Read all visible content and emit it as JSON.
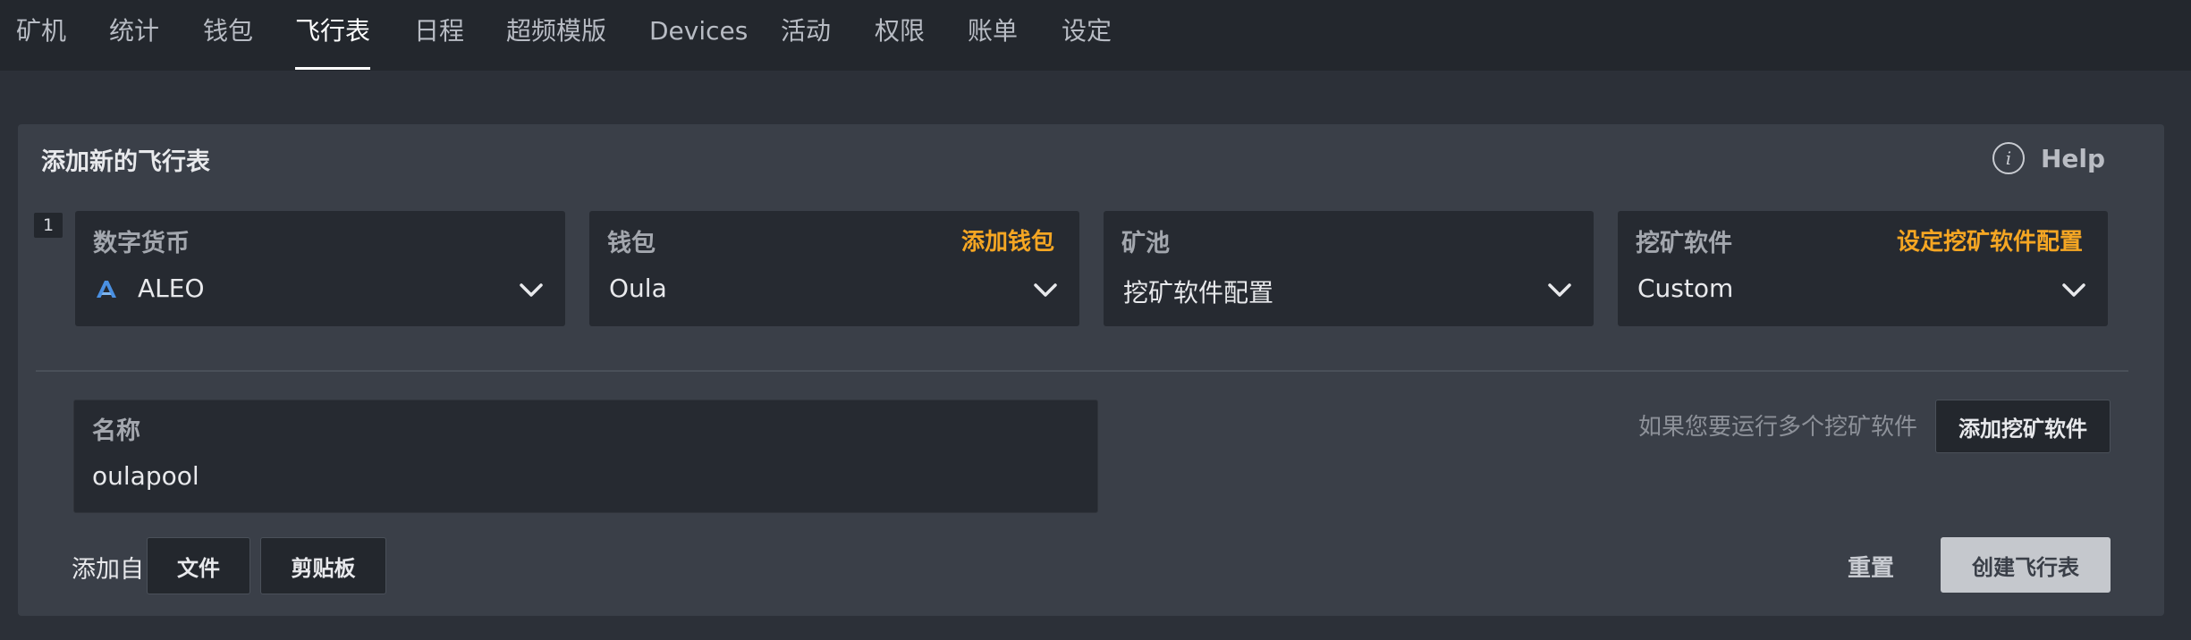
{
  "nav": {
    "tabs": [
      {
        "label": "矿机"
      },
      {
        "label": "统计"
      },
      {
        "label": "钱包"
      },
      {
        "label": "飞行表",
        "active": true
      },
      {
        "label": "日程"
      },
      {
        "label": "超频模版"
      },
      {
        "label": "Devices"
      },
      {
        "label": "活动"
      },
      {
        "label": "权限"
      },
      {
        "label": "账单"
      },
      {
        "label": "设定"
      }
    ]
  },
  "panel": {
    "title": "添加新的飞行表",
    "help_label": "Help",
    "help_icon": "info-icon",
    "row_number": "1",
    "fields": {
      "coin": {
        "label": "数字货币",
        "value": "ALEO",
        "icon": "aleo-logo-icon"
      },
      "wallet": {
        "label": "钱包",
        "link": "添加钱包",
        "value": "Oula"
      },
      "pool": {
        "label": "矿池",
        "value": "挖矿软件配置"
      },
      "miner": {
        "label": "挖矿软件",
        "link": "设定挖矿软件配置",
        "value": "Custom"
      }
    },
    "name": {
      "label": "名称",
      "value": "oulapool"
    },
    "multi_miner_hint": "如果您要运行多个挖矿软件",
    "add_miner_button": "添加挖矿软件",
    "add_from_label": "添加自",
    "file_button": "文件",
    "clipboard_button": "剪贴板",
    "reset_label": "重置",
    "create_button": "创建飞行表"
  },
  "colors": {
    "accent_link": "#f5a623",
    "nav_bg": "#23272d",
    "page_bg": "#2c3038",
    "panel_bg": "#3a3f48",
    "field_bg": "#262a31",
    "aleo_logo": "#4a90e2"
  }
}
